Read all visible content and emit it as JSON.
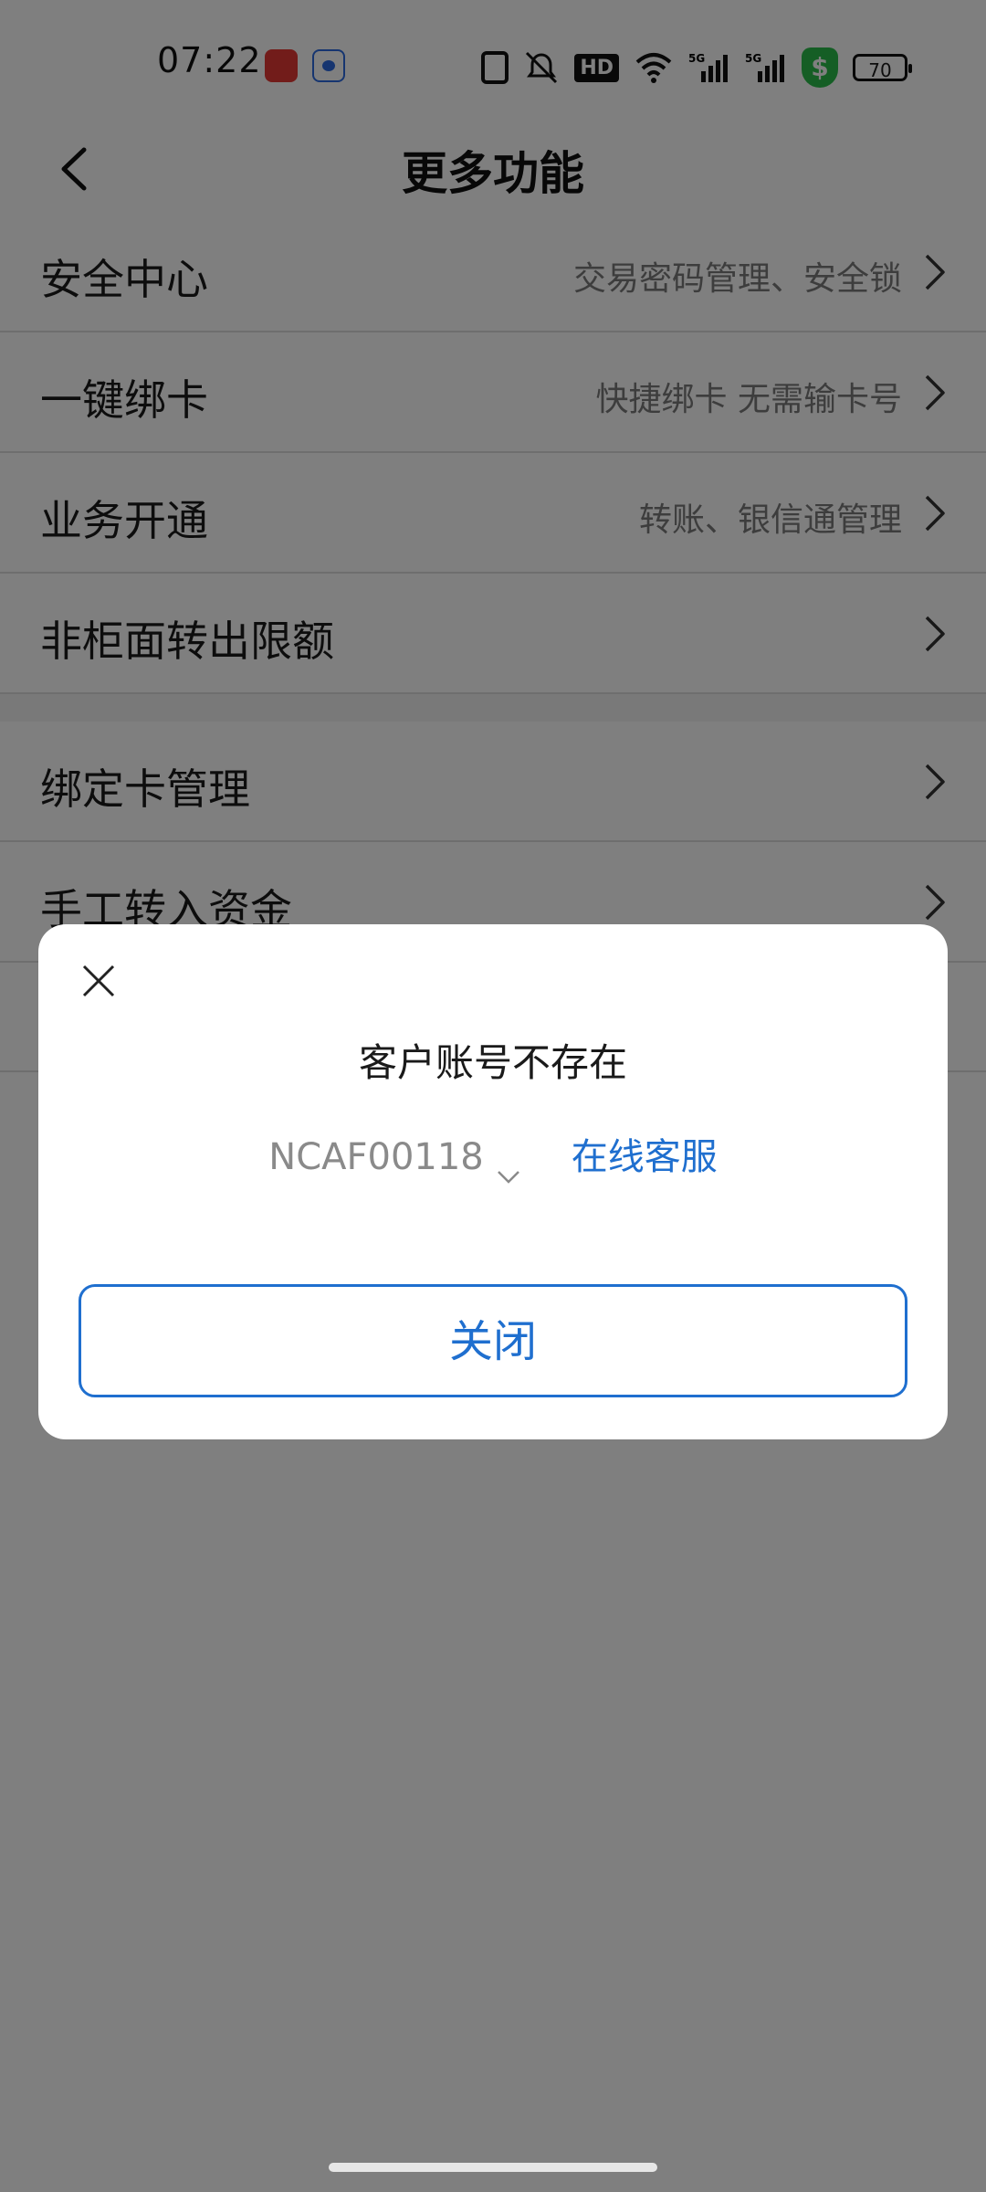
{
  "status_bar": {
    "time": "07:22",
    "battery": "70",
    "icons": [
      "nfc-icon",
      "mute-icon",
      "hd-icon",
      "wifi-icon",
      "signal-5g-icon",
      "signal-5g-icon",
      "shield-icon",
      "battery-icon"
    ],
    "hd_label": "HD",
    "shield_symbol": "$"
  },
  "header": {
    "title": "更多功能"
  },
  "menu": {
    "items": [
      {
        "label": "安全中心",
        "desc": "交易密码管理、安全锁"
      },
      {
        "label": "一键绑卡",
        "desc": "快捷绑卡 无需输卡号"
      },
      {
        "label": "业务开通",
        "desc": "转账、银信通管理"
      },
      {
        "label": "非柜面转出限额",
        "desc": ""
      },
      {
        "label": "绑定卡管理",
        "desc": ""
      },
      {
        "label": "手工转入资金",
        "desc": ""
      }
    ]
  },
  "dialog": {
    "message": "客户账号不存在",
    "error_code": "NCAF00118",
    "service_link": "在线客服",
    "close_button": "关闭"
  },
  "colors": {
    "accent": "#1f6fcf",
    "overlay": "rgba(0,0,0,0.5)"
  }
}
